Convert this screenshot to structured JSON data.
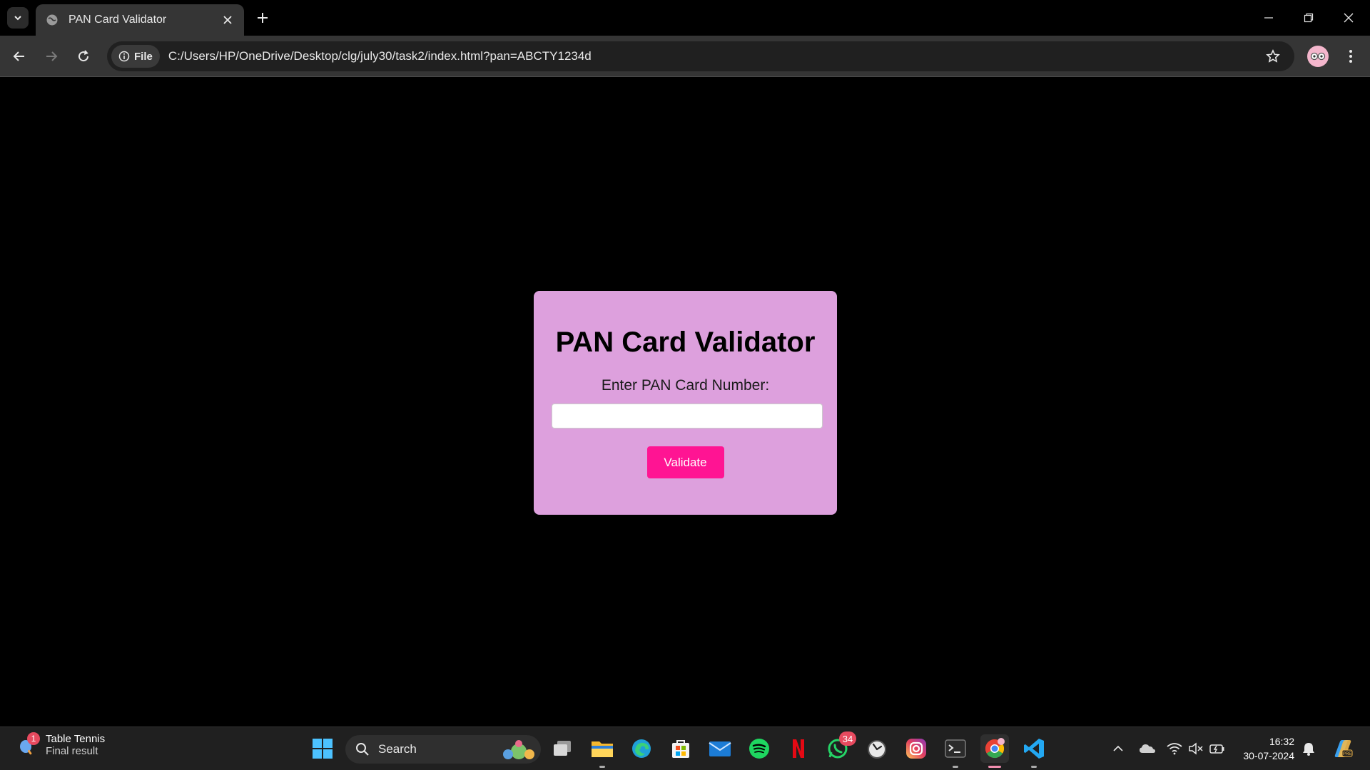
{
  "browser": {
    "tab_title": "PAN Card Validator",
    "security_chip": "File",
    "url": "C:/Users/HP/OneDrive/Desktop/clg/july30/task2/index.html?pan=ABCTY1234d"
  },
  "page": {
    "heading": "PAN Card Validator",
    "input_label": "Enter PAN Card Number:",
    "input_value": "",
    "button_label": "Validate"
  },
  "colors": {
    "card_bg": "#dda0dd",
    "button_bg": "#ff1493",
    "page_bg": "#000000"
  },
  "taskbar": {
    "widget_badge": "1",
    "widget_title": "Table Tennis",
    "widget_subtitle": "Final result",
    "search_label": "Search",
    "whatsapp_badge": "34",
    "time": "16:32",
    "date": "30-07-2024",
    "pinned_icons": [
      "windows-start-icon",
      "task-view-icon",
      "file-explorer-icon",
      "edge-icon",
      "microsoft-store-icon",
      "mail-icon",
      "spotify-icon",
      "netflix-icon",
      "whatsapp-icon",
      "clock-app-icon",
      "instagram-icon",
      "terminal-icon",
      "chrome-icon",
      "vscode-icon"
    ]
  }
}
